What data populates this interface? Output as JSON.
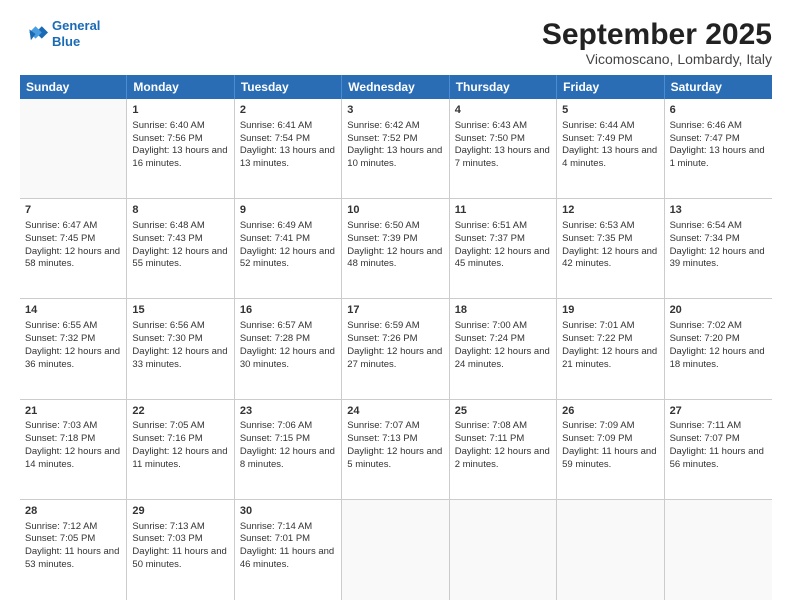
{
  "logo": {
    "line1": "General",
    "line2": "Blue"
  },
  "title": "September 2025",
  "location": "Vicomoscano, Lombardy, Italy",
  "days_of_week": [
    "Sunday",
    "Monday",
    "Tuesday",
    "Wednesday",
    "Thursday",
    "Friday",
    "Saturday"
  ],
  "weeks": [
    [
      {
        "day": null,
        "sunrise": null,
        "sunset": null,
        "daylight": null
      },
      {
        "day": "1",
        "sunrise": "Sunrise: 6:40 AM",
        "sunset": "Sunset: 7:56 PM",
        "daylight": "Daylight: 13 hours and 16 minutes."
      },
      {
        "day": "2",
        "sunrise": "Sunrise: 6:41 AM",
        "sunset": "Sunset: 7:54 PM",
        "daylight": "Daylight: 13 hours and 13 minutes."
      },
      {
        "day": "3",
        "sunrise": "Sunrise: 6:42 AM",
        "sunset": "Sunset: 7:52 PM",
        "daylight": "Daylight: 13 hours and 10 minutes."
      },
      {
        "day": "4",
        "sunrise": "Sunrise: 6:43 AM",
        "sunset": "Sunset: 7:50 PM",
        "daylight": "Daylight: 13 hours and 7 minutes."
      },
      {
        "day": "5",
        "sunrise": "Sunrise: 6:44 AM",
        "sunset": "Sunset: 7:49 PM",
        "daylight": "Daylight: 13 hours and 4 minutes."
      },
      {
        "day": "6",
        "sunrise": "Sunrise: 6:46 AM",
        "sunset": "Sunset: 7:47 PM",
        "daylight": "Daylight: 13 hours and 1 minute."
      }
    ],
    [
      {
        "day": "7",
        "sunrise": "Sunrise: 6:47 AM",
        "sunset": "Sunset: 7:45 PM",
        "daylight": "Daylight: 12 hours and 58 minutes."
      },
      {
        "day": "8",
        "sunrise": "Sunrise: 6:48 AM",
        "sunset": "Sunset: 7:43 PM",
        "daylight": "Daylight: 12 hours and 55 minutes."
      },
      {
        "day": "9",
        "sunrise": "Sunrise: 6:49 AM",
        "sunset": "Sunset: 7:41 PM",
        "daylight": "Daylight: 12 hours and 52 minutes."
      },
      {
        "day": "10",
        "sunrise": "Sunrise: 6:50 AM",
        "sunset": "Sunset: 7:39 PM",
        "daylight": "Daylight: 12 hours and 48 minutes."
      },
      {
        "day": "11",
        "sunrise": "Sunrise: 6:51 AM",
        "sunset": "Sunset: 7:37 PM",
        "daylight": "Daylight: 12 hours and 45 minutes."
      },
      {
        "day": "12",
        "sunrise": "Sunrise: 6:53 AM",
        "sunset": "Sunset: 7:35 PM",
        "daylight": "Daylight: 12 hours and 42 minutes."
      },
      {
        "day": "13",
        "sunrise": "Sunrise: 6:54 AM",
        "sunset": "Sunset: 7:34 PM",
        "daylight": "Daylight: 12 hours and 39 minutes."
      }
    ],
    [
      {
        "day": "14",
        "sunrise": "Sunrise: 6:55 AM",
        "sunset": "Sunset: 7:32 PM",
        "daylight": "Daylight: 12 hours and 36 minutes."
      },
      {
        "day": "15",
        "sunrise": "Sunrise: 6:56 AM",
        "sunset": "Sunset: 7:30 PM",
        "daylight": "Daylight: 12 hours and 33 minutes."
      },
      {
        "day": "16",
        "sunrise": "Sunrise: 6:57 AM",
        "sunset": "Sunset: 7:28 PM",
        "daylight": "Daylight: 12 hours and 30 minutes."
      },
      {
        "day": "17",
        "sunrise": "Sunrise: 6:59 AM",
        "sunset": "Sunset: 7:26 PM",
        "daylight": "Daylight: 12 hours and 27 minutes."
      },
      {
        "day": "18",
        "sunrise": "Sunrise: 7:00 AM",
        "sunset": "Sunset: 7:24 PM",
        "daylight": "Daylight: 12 hours and 24 minutes."
      },
      {
        "day": "19",
        "sunrise": "Sunrise: 7:01 AM",
        "sunset": "Sunset: 7:22 PM",
        "daylight": "Daylight: 12 hours and 21 minutes."
      },
      {
        "day": "20",
        "sunrise": "Sunrise: 7:02 AM",
        "sunset": "Sunset: 7:20 PM",
        "daylight": "Daylight: 12 hours and 18 minutes."
      }
    ],
    [
      {
        "day": "21",
        "sunrise": "Sunrise: 7:03 AM",
        "sunset": "Sunset: 7:18 PM",
        "daylight": "Daylight: 12 hours and 14 minutes."
      },
      {
        "day": "22",
        "sunrise": "Sunrise: 7:05 AM",
        "sunset": "Sunset: 7:16 PM",
        "daylight": "Daylight: 12 hours and 11 minutes."
      },
      {
        "day": "23",
        "sunrise": "Sunrise: 7:06 AM",
        "sunset": "Sunset: 7:15 PM",
        "daylight": "Daylight: 12 hours and 8 minutes."
      },
      {
        "day": "24",
        "sunrise": "Sunrise: 7:07 AM",
        "sunset": "Sunset: 7:13 PM",
        "daylight": "Daylight: 12 hours and 5 minutes."
      },
      {
        "day": "25",
        "sunrise": "Sunrise: 7:08 AM",
        "sunset": "Sunset: 7:11 PM",
        "daylight": "Daylight: 12 hours and 2 minutes."
      },
      {
        "day": "26",
        "sunrise": "Sunrise: 7:09 AM",
        "sunset": "Sunset: 7:09 PM",
        "daylight": "Daylight: 11 hours and 59 minutes."
      },
      {
        "day": "27",
        "sunrise": "Sunrise: 7:11 AM",
        "sunset": "Sunset: 7:07 PM",
        "daylight": "Daylight: 11 hours and 56 minutes."
      }
    ],
    [
      {
        "day": "28",
        "sunrise": "Sunrise: 7:12 AM",
        "sunset": "Sunset: 7:05 PM",
        "daylight": "Daylight: 11 hours and 53 minutes."
      },
      {
        "day": "29",
        "sunrise": "Sunrise: 7:13 AM",
        "sunset": "Sunset: 7:03 PM",
        "daylight": "Daylight: 11 hours and 50 minutes."
      },
      {
        "day": "30",
        "sunrise": "Sunrise: 7:14 AM",
        "sunset": "Sunset: 7:01 PM",
        "daylight": "Daylight: 11 hours and 46 minutes."
      },
      {
        "day": null,
        "sunrise": null,
        "sunset": null,
        "daylight": null
      },
      {
        "day": null,
        "sunrise": null,
        "sunset": null,
        "daylight": null
      },
      {
        "day": null,
        "sunrise": null,
        "sunset": null,
        "daylight": null
      },
      {
        "day": null,
        "sunrise": null,
        "sunset": null,
        "daylight": null
      }
    ]
  ]
}
